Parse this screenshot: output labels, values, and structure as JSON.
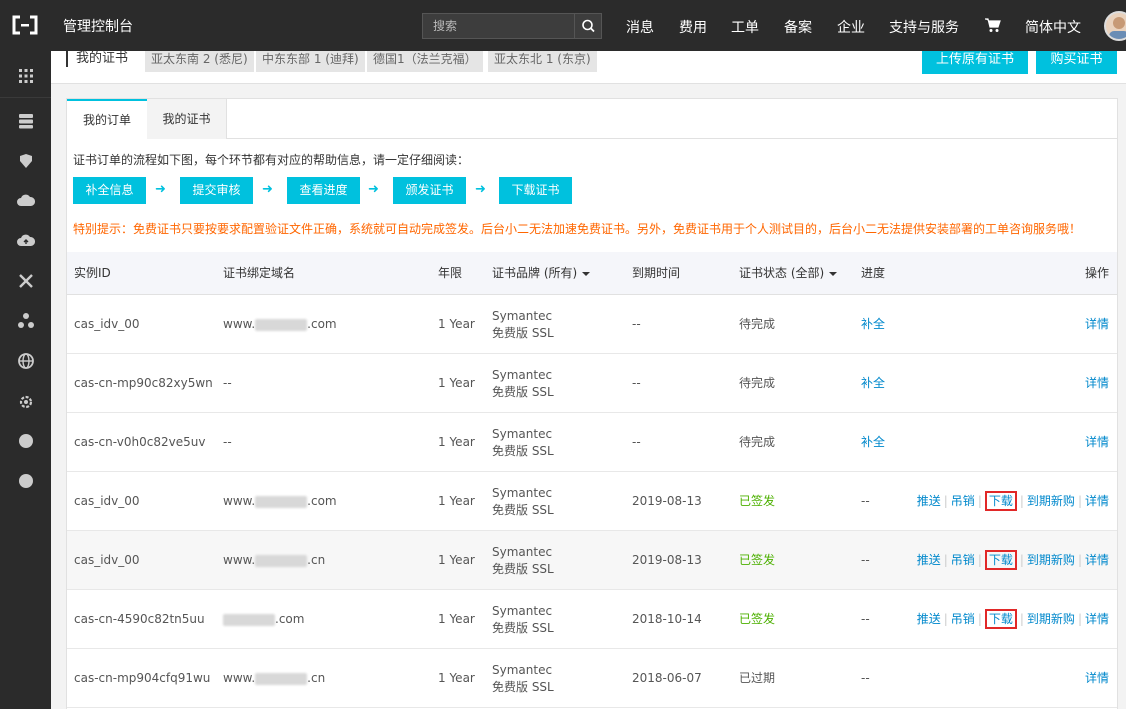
{
  "header": {
    "console_title": "管理控制台",
    "search_placeholder": "搜索",
    "nav": [
      "消息",
      "费用",
      "工单",
      "备案",
      "企业",
      "支持与服务",
      "简体中文"
    ]
  },
  "region_strip": {
    "label": "我的证书",
    "regions": [
      "亚太东南 2 (悉尼)",
      "中东东部 1 (迪拜)",
      "德国1（法兰克福）",
      "亚太东北 1 (东京)"
    ],
    "upload_button": "上传原有证书",
    "buy_button": "购买证书"
  },
  "tabs": [
    "我的订单",
    "我的证书"
  ],
  "flow": {
    "description": "证书订单的流程如下图，每个环节都有对应的帮助信息，请一定仔细阅读：",
    "steps": [
      "补全信息",
      "提交审核",
      "查看进度",
      "颁发证书",
      "下载证书"
    ]
  },
  "notice": "特别提示：免费证书只要按要求配置验证文件正确，系统就可自动完成签发。后台小二无法加速免费证书。另外，免费证书用于个人测试目的，后台小二无法提供安装部署的工单咨询服务哦！",
  "table": {
    "columns": [
      "实例ID",
      "证书绑定域名",
      "年限",
      "证书品牌 (所有)",
      "到期时间",
      "证书状态 (全部)",
      "进度",
      "操作"
    ],
    "rows": [
      {
        "id": "cas_idv_00",
        "domain_pre": "www.",
        "domain_post": ".com",
        "years": "1 Year",
        "brand1": "Symantec",
        "brand2": "免费版 SSL",
        "expire": "--",
        "status": "待完成",
        "progress": "补全",
        "ops": [
          "详情"
        ]
      },
      {
        "id": "cas-cn-mp90c82xy5wn",
        "domain_pre": "--",
        "domain_post": "",
        "years": "1 Year",
        "brand1": "Symantec",
        "brand2": "免费版 SSL",
        "expire": "--",
        "status": "待完成",
        "progress": "补全",
        "ops": [
          "详情"
        ]
      },
      {
        "id": "cas-cn-v0h0c82ve5uv",
        "domain_pre": "--",
        "domain_post": "",
        "years": "1 Year",
        "brand1": "Symantec",
        "brand2": "免费版 SSL",
        "expire": "--",
        "status": "待完成",
        "progress": "补全",
        "ops": [
          "详情"
        ]
      },
      {
        "id": "cas_idv_00",
        "domain_pre": "www.",
        "domain_post": ".com",
        "years": "1 Year",
        "brand1": "Symantec",
        "brand2": "免费版 SSL",
        "expire": "2019-08-13",
        "status": "已签发",
        "progress": "--",
        "ops": [
          "推送",
          "吊销",
          "下载",
          "到期新购",
          "详情"
        ]
      },
      {
        "id": "cas_idv_00",
        "domain_pre": "www.",
        "domain_post": ".cn",
        "years": "1 Year",
        "brand1": "Symantec",
        "brand2": "免费版 SSL",
        "expire": "2019-08-13",
        "status": "已签发",
        "progress": "--",
        "ops": [
          "推送",
          "吊销",
          "下载",
          "到期新购",
          "详情"
        ]
      },
      {
        "id": "cas-cn-4590c82tn5uu",
        "domain_pre": "",
        "domain_post": ".com",
        "years": "1 Year",
        "brand1": "Symantec",
        "brand2": "免费版 SSL",
        "expire": "2018-10-14",
        "status": "已签发",
        "progress": "--",
        "ops": [
          "推送",
          "吊销",
          "下载",
          "到期新购",
          "详情"
        ]
      },
      {
        "id": "cas-cn-mp904cfq91wu",
        "domain_pre": "www.",
        "domain_post": ".cn",
        "years": "1 Year",
        "brand1": "Symantec",
        "brand2": "免费版 SSL",
        "expire": "2018-06-07",
        "status": "已过期",
        "progress": "--",
        "ops": [
          "详情"
        ]
      }
    ]
  },
  "colors": {
    "accent": "#00c1de",
    "link": "#0088cc",
    "warning": "#ff6600",
    "signed": "#4cb000",
    "highlight": "#e12828"
  }
}
